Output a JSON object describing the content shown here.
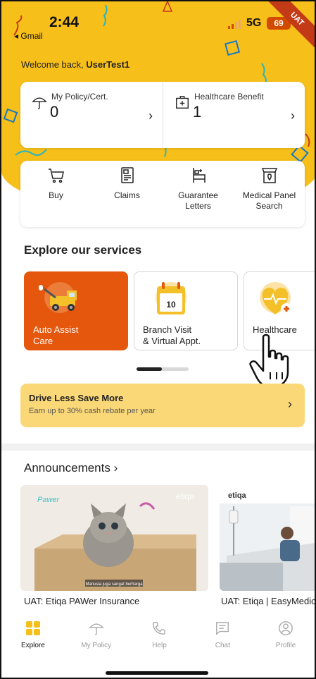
{
  "status_bar": {
    "time": "2:44",
    "back_app": "Gmail",
    "network": "5G",
    "battery": "69",
    "env_ribbon": "UAT"
  },
  "header": {
    "welcome_prefix": "Welcome back,",
    "username": "UserTest1"
  },
  "policy_summary": [
    {
      "label": "My Policy/Cert.",
      "count": "0",
      "icon": "umbrella-icon"
    },
    {
      "label": "Healthcare Benefit",
      "count": "1",
      "icon": "medical-kit-icon"
    }
  ],
  "quick_actions": [
    {
      "label": "Buy",
      "icon": "cart-icon"
    },
    {
      "label": "Claims",
      "icon": "claims-document-icon"
    },
    {
      "label": "Guarantee Letters",
      "icon": "hospital-bed-icon"
    },
    {
      "label": "Medical Panel Search",
      "icon": "clinic-location-icon"
    }
  ],
  "services": {
    "title": "Explore our services",
    "items": [
      {
        "label": "Auto Assist Care",
        "icon": "tow-truck-illustration"
      },
      {
        "label": "Branch Visit & Virtual Appt.",
        "icon": "calendar-illustration",
        "calendar_day": "10"
      },
      {
        "label": "Healthcare",
        "icon": "heart-health-illustration"
      }
    ]
  },
  "promo": {
    "title": "Drive Less Save More",
    "subtitle": "Earn up to 30% cash rebate per year"
  },
  "announcements": {
    "title": "Announcements",
    "items": [
      {
        "caption": "UAT: Etiqa PAWer Insurance",
        "image_brand": "etiqa",
        "image_overlay": "Manusia juga sangat berharga"
      },
      {
        "caption": "UAT: Etiqa | EasyMedic",
        "image_brand": "etiqa"
      }
    ]
  },
  "tabs": [
    {
      "label": "Explore",
      "icon": "explore-grid-icon",
      "active": true
    },
    {
      "label": "My Policy",
      "icon": "umbrella-icon",
      "active": false
    },
    {
      "label": "Help",
      "icon": "phone-icon",
      "active": false
    },
    {
      "label": "Chat",
      "icon": "chat-icon",
      "active": false
    },
    {
      "label": "Profile",
      "icon": "profile-icon",
      "active": false
    }
  ],
  "colors": {
    "brand_yellow": "#f6bf1a",
    "accent_orange": "#e4570c",
    "promo_yellow": "#fbd877"
  }
}
